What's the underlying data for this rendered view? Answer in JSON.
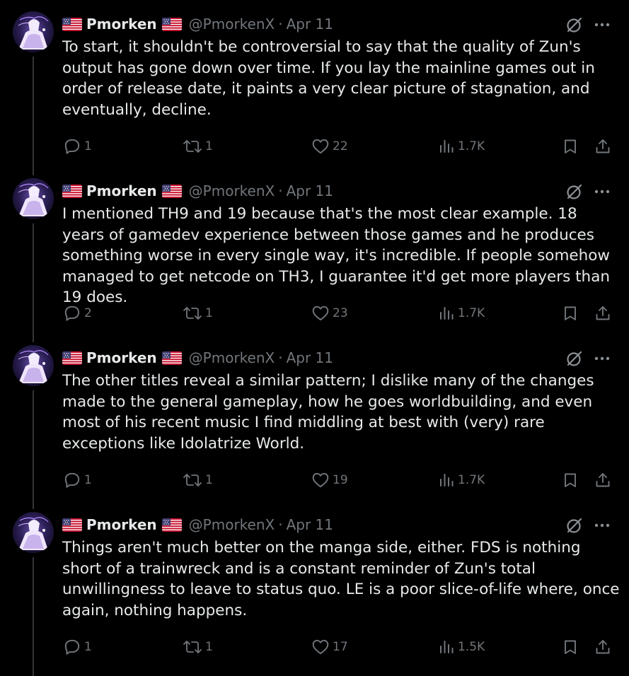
{
  "colors": {
    "background": "#000000",
    "text": "#e7e9ea",
    "muted": "#71767b",
    "thread_line": "#333639"
  },
  "tweets": [
    {
      "name": "Pmorken",
      "handle": "@PmorkenX",
      "separator": "·",
      "date": "Apr 11",
      "text": "To start, it shouldn't be controversial to say that the quality of Zun's output has gone down over time. If you lay the mainline games out in order of release date, it paints a very clear picture of stagnation, and eventually, decline.",
      "replies": "1",
      "reposts": "1",
      "likes": "22",
      "views": "1.7K"
    },
    {
      "name": "Pmorken",
      "handle": "@PmorkenX",
      "separator": "·",
      "date": "Apr 11",
      "text": "I mentioned TH9 and 19 because that's the most clear example. 18 years of gamedev experience between those games and he produces something worse in every single way, it's incredible. If people somehow managed to get netcode on TH3, I guarantee it'd get more players than 19 does.",
      "replies": "2",
      "reposts": "1",
      "likes": "23",
      "views": "1.7K"
    },
    {
      "name": "Pmorken",
      "handle": "@PmorkenX",
      "separator": "·",
      "date": "Apr 11",
      "text": "The other titles reveal a similar pattern; I dislike many of the changes made to the general gameplay, how he goes worldbuilding, and even most of his recent music I find middling at best with (very) rare exceptions like Idolatrize World.",
      "replies": "1",
      "reposts": "1",
      "likes": "19",
      "views": "1.7K"
    },
    {
      "name": "Pmorken",
      "handle": "@PmorkenX",
      "separator": "·",
      "date": "Apr 11",
      "text": "Things aren't much better on the manga side, either. FDS is nothing short of a trainwreck and is a constant reminder of Zun's total unwillingness to leave to status quo. LE is a poor slice-of-life where, once again, nothing happens.",
      "replies": "1",
      "reposts": "1",
      "likes": "17",
      "views": "1.5K"
    }
  ]
}
